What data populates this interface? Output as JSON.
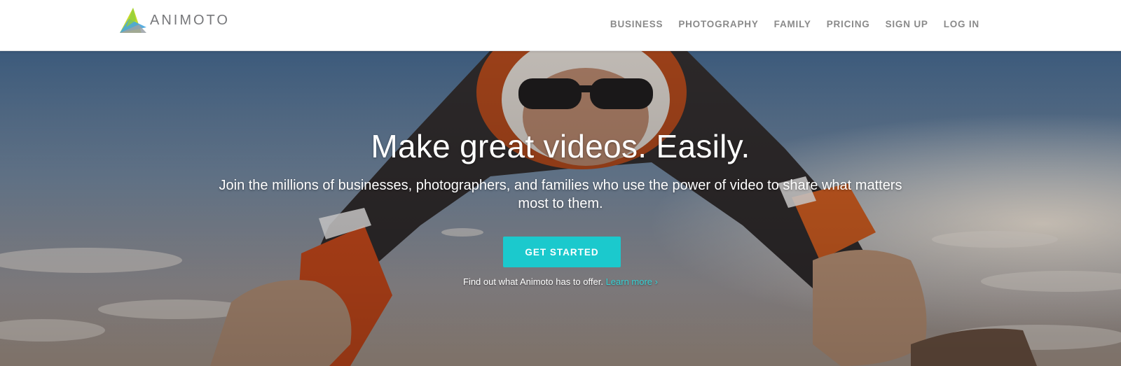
{
  "brand": {
    "name": "ANIMOTO",
    "colors": {
      "teal": "#1bc9cd",
      "green": "#c6d92b",
      "blue": "#46a5dd",
      "gray": "#8a8a8a"
    }
  },
  "nav": {
    "items": [
      {
        "label": "BUSINESS"
      },
      {
        "label": "PHOTOGRAPHY"
      },
      {
        "label": "FAMILY"
      },
      {
        "label": "PRICING"
      },
      {
        "label": "SIGN UP"
      },
      {
        "label": "LOG IN"
      }
    ]
  },
  "hero": {
    "headline": "Make great videos. Easily.",
    "subheadline": "Join the millions of businesses, photographers, and families who use the power of video to share what matters most to them.",
    "cta_label": "GET STARTED",
    "learn_text": "Find out what Animoto has to offer. ",
    "learn_link": "Learn more ›",
    "background_image": "skydiver-photo"
  }
}
